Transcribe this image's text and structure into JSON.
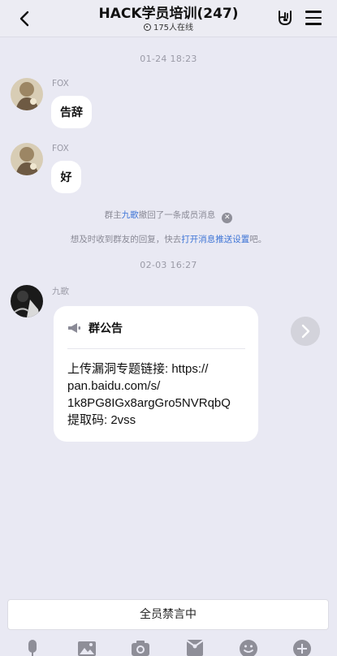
{
  "header": {
    "title": "HACK学员培训(247)",
    "online": "175人在线"
  },
  "messages": [
    {
      "time": "01-24 18:23",
      "sender": "FOX",
      "text": "告辞"
    },
    {
      "sender": "FOX",
      "text": "好"
    }
  ],
  "system": {
    "recall_prefix": "群主",
    "recall_name": "九歌",
    "recall_suffix": "撤回了一条成员消息",
    "tip_prefix": "想及时收到群友的回复，快去",
    "tip_link": "打开消息推送设置",
    "tip_suffix": "吧。"
  },
  "announcement": {
    "time": "02-03 16:27",
    "sender": "九歌",
    "title": "群公告",
    "lines": [
      "上传漏洞专题链接: https://",
      "pan.baidu.com/s/",
      "1k8PG8IGx8argGro5NVRqbQ",
      "提取码: 2vss"
    ]
  },
  "footer": {
    "mute_label": "全员禁言中"
  },
  "icons": [
    "back-icon",
    "rock-hand-icon",
    "menu-icon",
    "megaphone-icon",
    "forward-icon",
    "microphone-icon",
    "image-icon",
    "camera-icon",
    "red-packet-icon",
    "emoji-icon",
    "plus-icon"
  ],
  "colors": {
    "link": "#3d74d6",
    "background": "#e9e9f3"
  }
}
